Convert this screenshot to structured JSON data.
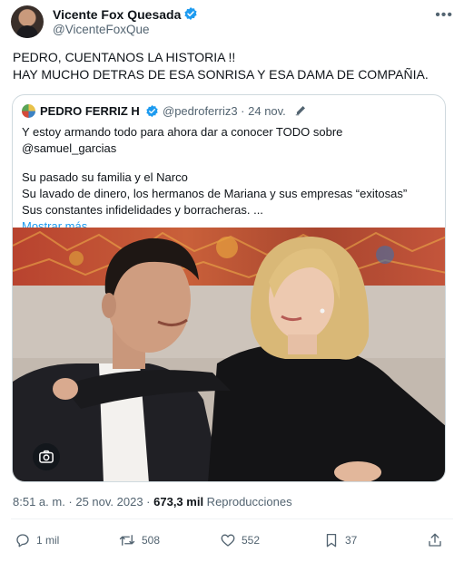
{
  "author": {
    "name": "Vicente Fox Quesada",
    "handle": "@VicenteFoxQue"
  },
  "tweet": {
    "line1": "PEDRO, CUENTANOS LA HISTORIA !!",
    "line2": "HAY MUCHO DETRAS DE ESA SONRISA Y ESA DAMA DE COMPAÑIA."
  },
  "quote": {
    "name": "PEDRO FERRIZ H",
    "handle_date": "@pedroferriz3 · 24 nov.",
    "text_lines": [
      "Y estoy armando todo para ahora dar a conocer TODO sobre @samuel_garcias",
      "Su pasado su familia y  el Narco",
      "Su lavado de dinero, los hermanos de Mariana y sus empresas “exitosas”",
      "Sus constantes infidelidades y borracheras. ..."
    ],
    "show_more": "Mostrar más"
  },
  "meta": {
    "time_date": "8:51 a. m. · 25 nov. 2023 · ",
    "views_count": "673,3 mil",
    "views_label": " Reproducciones"
  },
  "actions": {
    "replies": "1 mil",
    "reposts": "508",
    "likes": "552",
    "bookmarks": "37"
  },
  "colors": {
    "accent": "#1d9bf0",
    "secondary_text": "#536471",
    "border": "#cfd9de"
  },
  "icons": [
    "verified-badge-icon",
    "more-icon",
    "pen-icon",
    "lens-icon",
    "reply-icon",
    "repost-icon",
    "like-icon",
    "bookmark-icon",
    "share-icon"
  ]
}
